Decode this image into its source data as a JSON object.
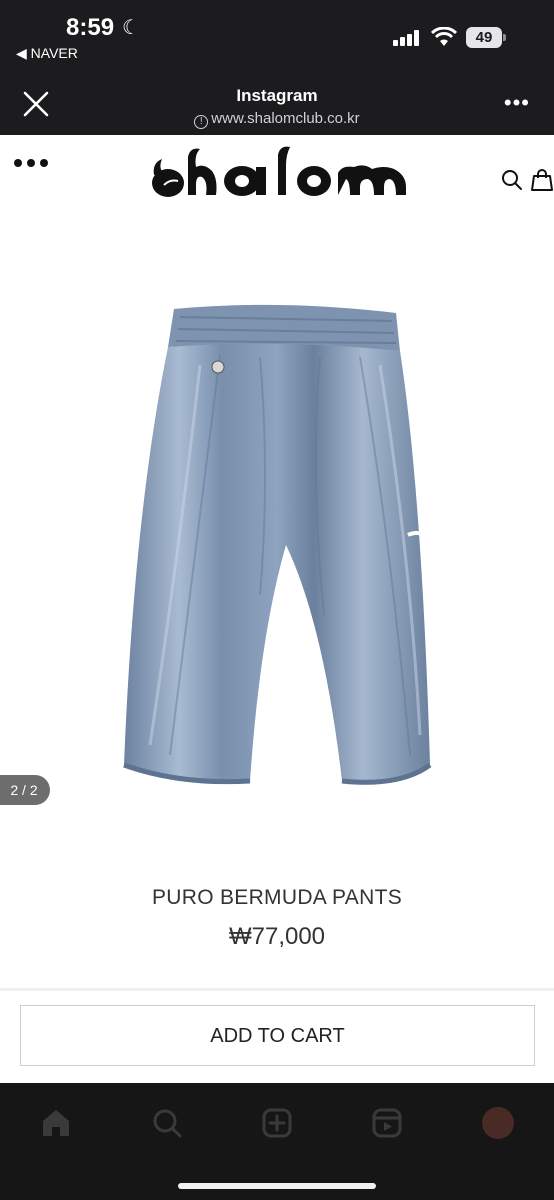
{
  "status_bar": {
    "time": "8:59",
    "back_app": "◀ NAVER",
    "battery": "49"
  },
  "browser": {
    "title": "Instagram",
    "url": "www.shalomclub.co.kr"
  },
  "site": {
    "logo_text": "shalom"
  },
  "product": {
    "image_counter": "2 / 2",
    "name": "PURO BERMUDA PANTS",
    "price": "₩77,000",
    "image_color": "#7f95b2"
  },
  "actions": {
    "add_to_cart": "ADD TO CART"
  },
  "app_nav": {
    "items": [
      "home-icon",
      "search-icon",
      "create-icon",
      "reels-icon",
      "profile-avatar"
    ]
  }
}
